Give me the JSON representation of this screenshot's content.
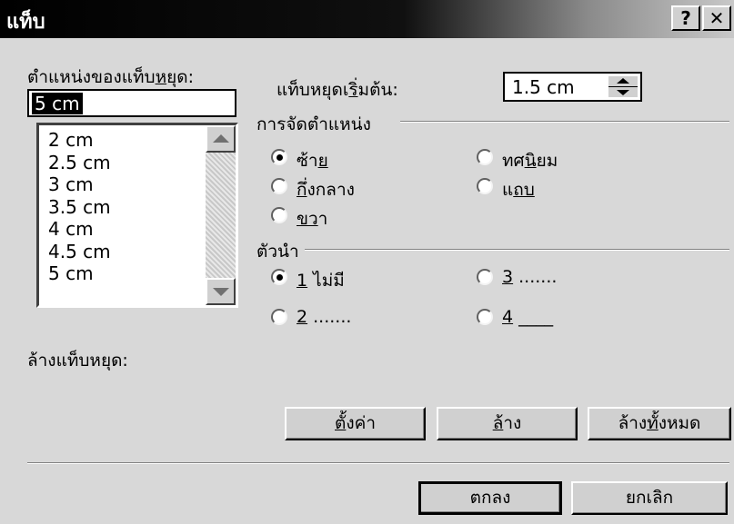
{
  "window": {
    "title": "แท็บ",
    "help_label": "?",
    "close_label": "✕"
  },
  "tab_position": {
    "label_prefix": "ตำแหน่งของแท็บ",
    "label_accel": "ห",
    "label_suffix": "ยุด:",
    "value": "5 cm",
    "list": [
      "2 cm",
      "2.5 cm",
      "3 cm",
      "3.5 cm",
      "4 cm",
      "4.5 cm",
      "5 cm"
    ]
  },
  "default_tab_stops": {
    "label_prefix": "แท็บหยุดเ",
    "label_accel": "ริ่",
    "label_suffix": "มต้น:",
    "value": "1.5 cm"
  },
  "alignment": {
    "title": "การจัดตำแหน่ง",
    "options": [
      {
        "pre": "ซ้า",
        "accel": "ย",
        "post": "",
        "checked": true
      },
      {
        "pre": "ทศ",
        "accel": "นิ",
        "post": "ยม",
        "checked": false
      },
      {
        "pre": "",
        "accel": "กึ่",
        "post": "งกลาง",
        "checked": false
      },
      {
        "pre": "แ",
        "accel": "ถบ",
        "post": "",
        "checked": false
      },
      {
        "pre": "",
        "accel": "ขว",
        "post": "า",
        "checked": false
      }
    ]
  },
  "leader": {
    "title": "ตัวนำ",
    "options": [
      {
        "accel": "1",
        "post": " ไม่มี",
        "checked": true
      },
      {
        "accel": "3",
        "post": " .......",
        "checked": false
      },
      {
        "accel": "2",
        "post": " .......",
        "checked": false
      },
      {
        "accel": "4",
        "post": " ____",
        "checked": false
      }
    ]
  },
  "clear_label": "ล้างแท็บหยุด:",
  "buttons": {
    "set": {
      "accel": "ตั้",
      "post": "งค่า"
    },
    "clear": {
      "accel": "ล้",
      "post": "าง"
    },
    "clear_all": {
      "pre": "ล้าง",
      "accel": "ทั้",
      "post": "งหมด"
    },
    "ok": "ตกลง",
    "cancel": "ยกเลิก"
  }
}
